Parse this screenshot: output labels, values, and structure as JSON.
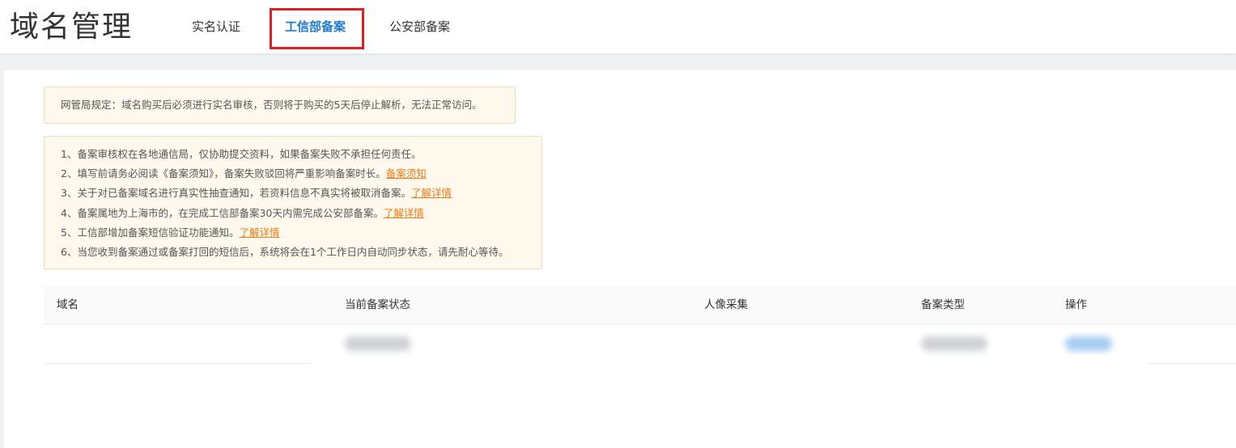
{
  "header": {
    "title": "域名管理",
    "tabs": [
      {
        "label": "实名认证",
        "active": false
      },
      {
        "label": "工信部备案",
        "active": true
      },
      {
        "label": "公安部备案",
        "active": false
      }
    ]
  },
  "notice": {
    "text": "网管局规定：域名购买后必须进行实名审核，否则将于购买的5天后停止解析，无法正常访问。"
  },
  "tips": [
    {
      "text": "1、备案审核权在各地通信局，仅协助提交资料，如果备案失败不承担任何责任。",
      "link": ""
    },
    {
      "text": "2、填写前请务必阅读《备案须知》，备案失败驳回将严重影响备案时长。",
      "link": "备案须知"
    },
    {
      "text": "3、关于对已备案域名进行真实性抽查通知，若资料信息不真实将被取消备案。",
      "link": "了解详情"
    },
    {
      "text": "4、备案属地为上海市的，在完成工信部备案30天内需完成公安部备案。",
      "link": "了解详情"
    },
    {
      "text": "5、工信部增加备案短信验证功能通知。",
      "link": "了解详情"
    },
    {
      "text": "6、当您收到备案通过或备案打回的短信后，系统将会在1个工作日内自动同步状态，请先耐心等待。",
      "link": ""
    }
  ],
  "table": {
    "columns": [
      "域名",
      "当前备案状态",
      "人像采集",
      "备案类型",
      "操作"
    ]
  },
  "colors": {
    "accent": "#1e7ad6",
    "highlight": "#e02020",
    "link": "#f07d17",
    "notice_bg": "#fff8ed"
  }
}
